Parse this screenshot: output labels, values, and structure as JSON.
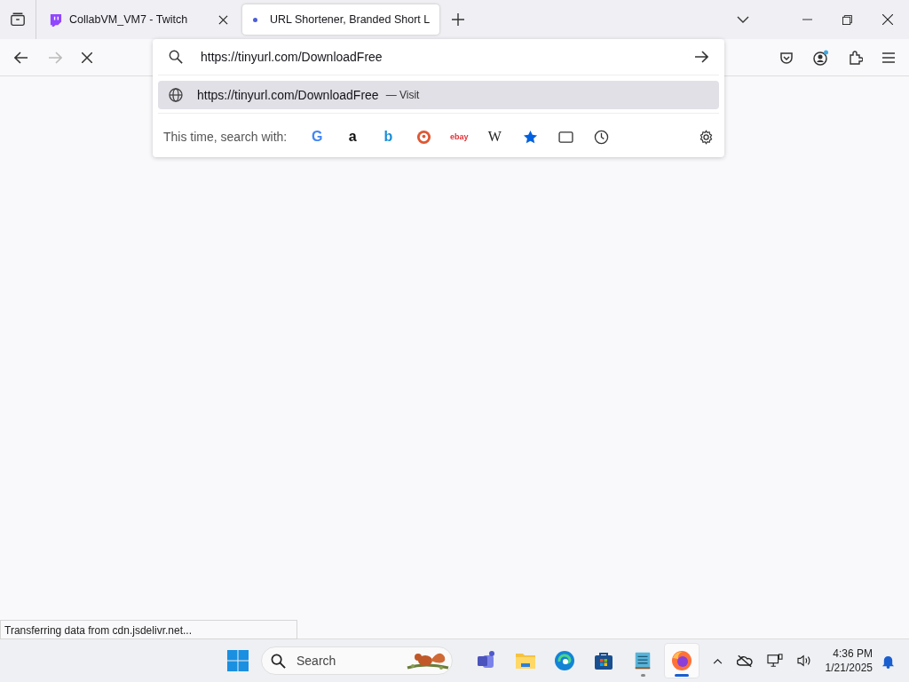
{
  "tabs": [
    {
      "title": "CollabVM_VM7 - Twitch",
      "kind": "twitch",
      "selected": false
    },
    {
      "title": "URL Shortener, Branded Short L",
      "kind": "loading",
      "selected": true
    }
  ],
  "urlbar": {
    "value": "https://tinyurl.com/DownloadFree"
  },
  "suggestions": [
    {
      "url": "https://tinyurl.com/DownloadFree",
      "action": "— Visit",
      "selected": true
    }
  ],
  "search_with": {
    "label": "This time, search with:",
    "engines": [
      {
        "kind": "google",
        "glyph": "G"
      },
      {
        "kind": "amazon",
        "glyph": "a"
      },
      {
        "kind": "bing",
        "glyph": "b"
      },
      {
        "kind": "duckduckgo"
      },
      {
        "kind": "ebay",
        "glyph": "ebay"
      },
      {
        "kind": "wikipedia",
        "glyph": "W"
      },
      {
        "kind": "bookmarks"
      },
      {
        "kind": "tabs"
      },
      {
        "kind": "history"
      }
    ]
  },
  "status_bar": {
    "text": "Transferring data from cdn.jsdelivr.net..."
  },
  "taskbar": {
    "search_placeholder": "Search",
    "apps": [
      {
        "kind": "teams",
        "running": false,
        "active": false
      },
      {
        "kind": "files",
        "running": false,
        "active": false
      },
      {
        "kind": "edge",
        "running": false,
        "active": false
      },
      {
        "kind": "store",
        "running": false,
        "active": false
      },
      {
        "kind": "notepad",
        "running": true,
        "active": false
      },
      {
        "kind": "firefox",
        "running": true,
        "active": true
      }
    ],
    "time": "4:36 PM",
    "date": "1/21/2025"
  }
}
